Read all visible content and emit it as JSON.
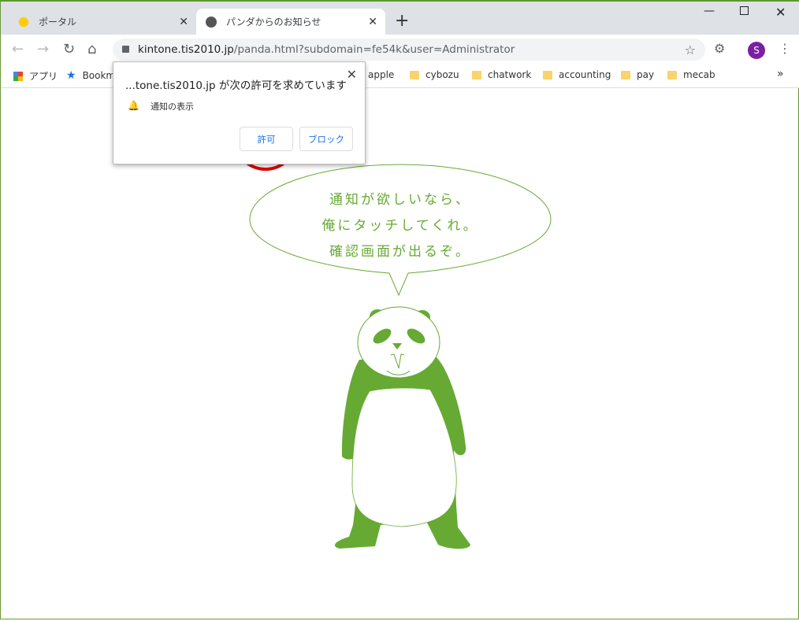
{
  "tabs": [
    {
      "label": "ポータル",
      "icon": "kintone-icon"
    },
    {
      "label": "パンダからのお知らせ",
      "icon": "globe-icon",
      "active": true
    }
  ],
  "address": {
    "host": "kintone.tis2010.jp",
    "path": "/panda.html?subdomain=fe54k&user=Administrator"
  },
  "profile_initial": "S",
  "bookmarks": [
    "アプリ",
    "Bookm",
    "apple",
    "cybozu",
    "chatwork",
    "accounting",
    "pay",
    "mecab"
  ],
  "popup": {
    "title": "...tone.tis2010.jp が次の許可を求めています",
    "permission": "通知の表示",
    "allow": "許可",
    "block": "ブロック"
  },
  "speech": [
    "通知が欲しいなら、",
    "俺にタッチしてくれ。",
    "確認画面が出るぞ。"
  ],
  "colors": {
    "panda": "#66aa33",
    "highlight": "#e00000",
    "profile": "#7b1fa2"
  }
}
